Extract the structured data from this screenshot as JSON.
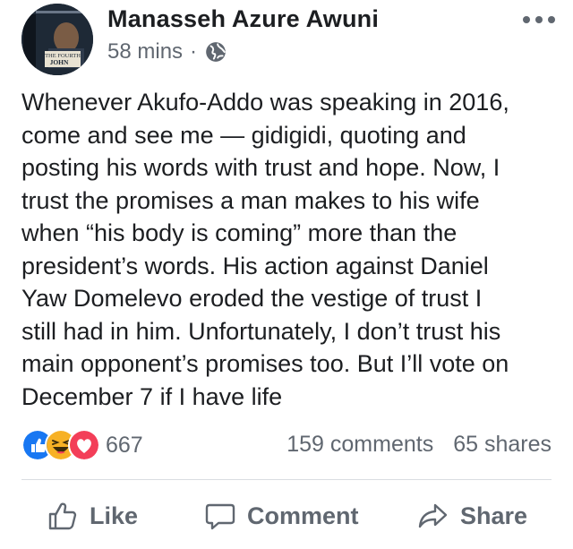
{
  "post": {
    "author": "Manasseh Azure Awuni",
    "time": "58 mins",
    "separator": "·",
    "privacy_icon": "globe-icon",
    "avatar": {
      "line1": "THE FOURTH",
      "line2": "JOHN"
    },
    "text": "Whenever Akufo-Addo was speaking in 2016,\ncome and see me — gidigidi, quoting and\nposting his words with trust and hope. Now, I\ntrust the promises a man makes to his wife\nwhen “his body is coming” more than the\npresident’s words. His action against Daniel\nYaw Domelevo eroded the vestige of trust I\nstill had in him. Unfortunately, I don’t trust his\nmain opponent’s promises too. But I’ll vote on\nDecember 7 if I have life"
  },
  "stats": {
    "reactions": [
      "like-reaction-icon",
      "haha-reaction-icon",
      "love-reaction-icon"
    ],
    "reaction_count": "667",
    "comments": "159 comments",
    "shares": "65 shares"
  },
  "actions": {
    "like": "Like",
    "comment": "Comment",
    "share": "Share"
  },
  "colors": {
    "like_blue": "#1877f2",
    "love_red": "#f33e58",
    "haha_yellow": "#f7b125",
    "secondary_text": "#606770"
  }
}
